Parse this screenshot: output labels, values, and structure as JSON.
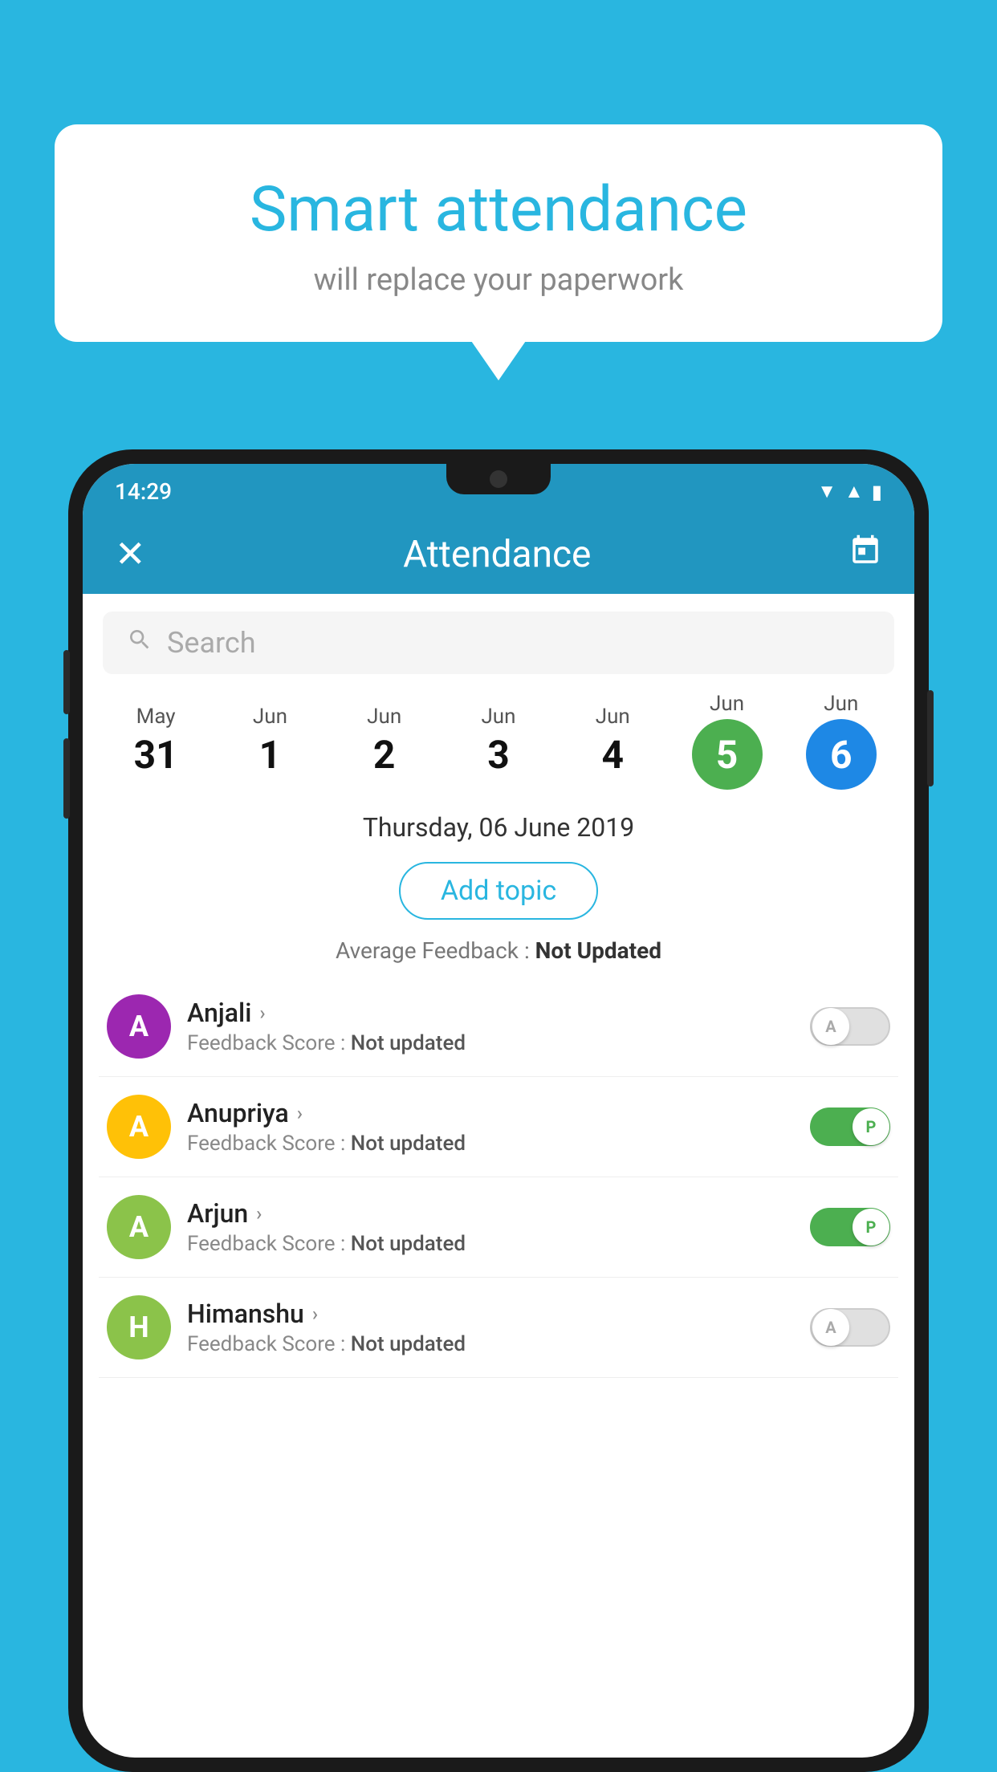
{
  "background_color": "#29B6E0",
  "bubble": {
    "title": "Smart attendance",
    "subtitle": "will replace your paperwork"
  },
  "status_bar": {
    "time": "14:29",
    "icons": [
      "wifi",
      "signal",
      "battery"
    ]
  },
  "app_bar": {
    "title": "Attendance",
    "close_label": "✕",
    "calendar_label": "📅"
  },
  "search": {
    "placeholder": "Search"
  },
  "dates": [
    {
      "month": "May",
      "day": "31",
      "selected": false
    },
    {
      "month": "Jun",
      "day": "1",
      "selected": false
    },
    {
      "month": "Jun",
      "day": "2",
      "selected": false
    },
    {
      "month": "Jun",
      "day": "3",
      "selected": false
    },
    {
      "month": "Jun",
      "day": "4",
      "selected": false
    },
    {
      "month": "Jun",
      "day": "5",
      "selected": "green"
    },
    {
      "month": "Jun",
      "day": "6",
      "selected": "blue"
    }
  ],
  "selected_date": "Thursday, 06 June 2019",
  "add_topic_label": "Add topic",
  "average_feedback": {
    "label": "Average Feedback : ",
    "value": "Not Updated"
  },
  "students": [
    {
      "name": "Anjali",
      "avatar_letter": "A",
      "avatar_color": "#9C27B0",
      "feedback_label": "Feedback Score : ",
      "feedback_value": "Not updated",
      "toggle": "off",
      "toggle_letter": "A"
    },
    {
      "name": "Anupriya",
      "avatar_letter": "A",
      "avatar_color": "#FFC107",
      "feedback_label": "Feedback Score : ",
      "feedback_value": "Not updated",
      "toggle": "on",
      "toggle_letter": "P"
    },
    {
      "name": "Arjun",
      "avatar_letter": "A",
      "avatar_color": "#8BC34A",
      "feedback_label": "Feedback Score : ",
      "feedback_value": "Not updated",
      "toggle": "on",
      "toggle_letter": "P"
    },
    {
      "name": "Himanshu",
      "avatar_letter": "H",
      "avatar_color": "#8BC34A",
      "feedback_label": "Feedback Score : ",
      "feedback_value": "Not updated",
      "toggle": "off",
      "toggle_letter": "A"
    }
  ]
}
